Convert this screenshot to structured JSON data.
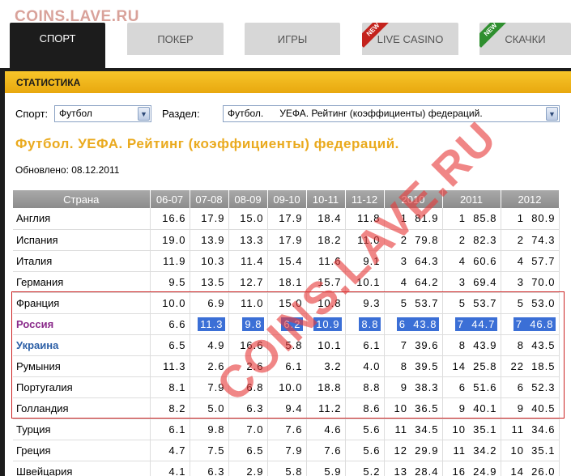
{
  "watermark": "COINS.LAVE.RU",
  "tabs": [
    {
      "label": "СПОРТ",
      "active": true
    },
    {
      "label": "ПОКЕР"
    },
    {
      "label": "ИГРЫ"
    },
    {
      "label": "LIVE CASINO",
      "badge": "NEW"
    },
    {
      "label": "СКАЧКИ",
      "badge": "NEW"
    }
  ],
  "section_title": "СТАТИСТИКА",
  "filters": {
    "sport_label": "Спорт:",
    "sport_value": "Футбол",
    "section_label": "Раздел:",
    "section_value": "Футбол.      УЕФА. Рейтинг (коэффициенты) федераций."
  },
  "page_title": "Футбол. УЕФА. Рейтинг (коэффициенты) федераций.",
  "updated": "Обновлено: 08.12.2011",
  "table": {
    "headers": [
      "Страна",
      "06-07",
      "07-08",
      "08-09",
      "09-10",
      "10-11",
      "11-12",
      "2010",
      "2011",
      "2012"
    ],
    "rows": [
      {
        "country": "Англия",
        "c": [
          "16.6",
          "17.9",
          "15.0",
          "17.9",
          "18.4",
          "11.8",
          "1  81.9",
          "1  85.8",
          "1  80.9"
        ]
      },
      {
        "country": "Испания",
        "c": [
          "19.0",
          "13.9",
          "13.3",
          "17.9",
          "18.2",
          "11.0",
          "2  79.8",
          "2  82.3",
          "2  74.3"
        ]
      },
      {
        "country": "Италия",
        "c": [
          "11.9",
          "10.3",
          "11.4",
          "15.4",
          "11.6",
          "9.1",
          "3  64.3",
          "4  60.6",
          "4  57.7"
        ]
      },
      {
        "country": "Германия",
        "c": [
          "9.5",
          "13.5",
          "12.7",
          "18.1",
          "15.7",
          "10.1",
          "4  64.2",
          "3  69.4",
          "3  70.0"
        ]
      },
      {
        "country": "Франция",
        "c": [
          "10.0",
          "6.9",
          "11.0",
          "15.0",
          "10.8",
          "9.3",
          "5  53.7",
          "5  53.7",
          "5  53.0"
        ]
      },
      {
        "country": "Россия",
        "c": [
          "6.6",
          "11.3",
          "9.8",
          "6.2",
          "10.9",
          "8.8",
          "6  43.8",
          "7  44.7",
          "7  46.8"
        ],
        "style": "purple",
        "highlight": true
      },
      {
        "country": "Украина",
        "c": [
          "6.5",
          "4.9",
          "16.6",
          "5.8",
          "10.1",
          "6.1",
          "7  39.6",
          "8  43.9",
          "8  43.5"
        ],
        "style": "blue"
      },
      {
        "country": "Румыния",
        "c": [
          "11.3",
          "2.6",
          "2.6",
          "6.1",
          "3.2",
          "4.0",
          "8  39.5",
          "14  25.8",
          "22  18.5"
        ]
      },
      {
        "country": "Португалия",
        "c": [
          "8.1",
          "7.9",
          "6.8",
          "10.0",
          "18.8",
          "8.8",
          "9  38.3",
          "6  51.6",
          "6  52.3"
        ]
      },
      {
        "country": "Голландия",
        "c": [
          "8.2",
          "5.0",
          "6.3",
          "9.4",
          "11.2",
          "8.6",
          "10  36.5",
          "9  40.1",
          "9  40.5"
        ]
      },
      {
        "country": "Турция",
        "c": [
          "6.1",
          "9.8",
          "7.0",
          "7.6",
          "4.6",
          "5.6",
          "11  34.5",
          "10  35.1",
          "11  34.6"
        ]
      },
      {
        "country": "Греция",
        "c": [
          "4.7",
          "7.5",
          "6.5",
          "7.9",
          "7.6",
          "5.6",
          "12  29.9",
          "11  34.2",
          "10  35.1"
        ]
      },
      {
        "country": "Швейцария",
        "c": [
          "4.1",
          "6.3",
          "2.9",
          "5.8",
          "5.9",
          "5.2",
          "13  28.4",
          "16  24.9",
          "14  26.0"
        ]
      }
    ]
  }
}
